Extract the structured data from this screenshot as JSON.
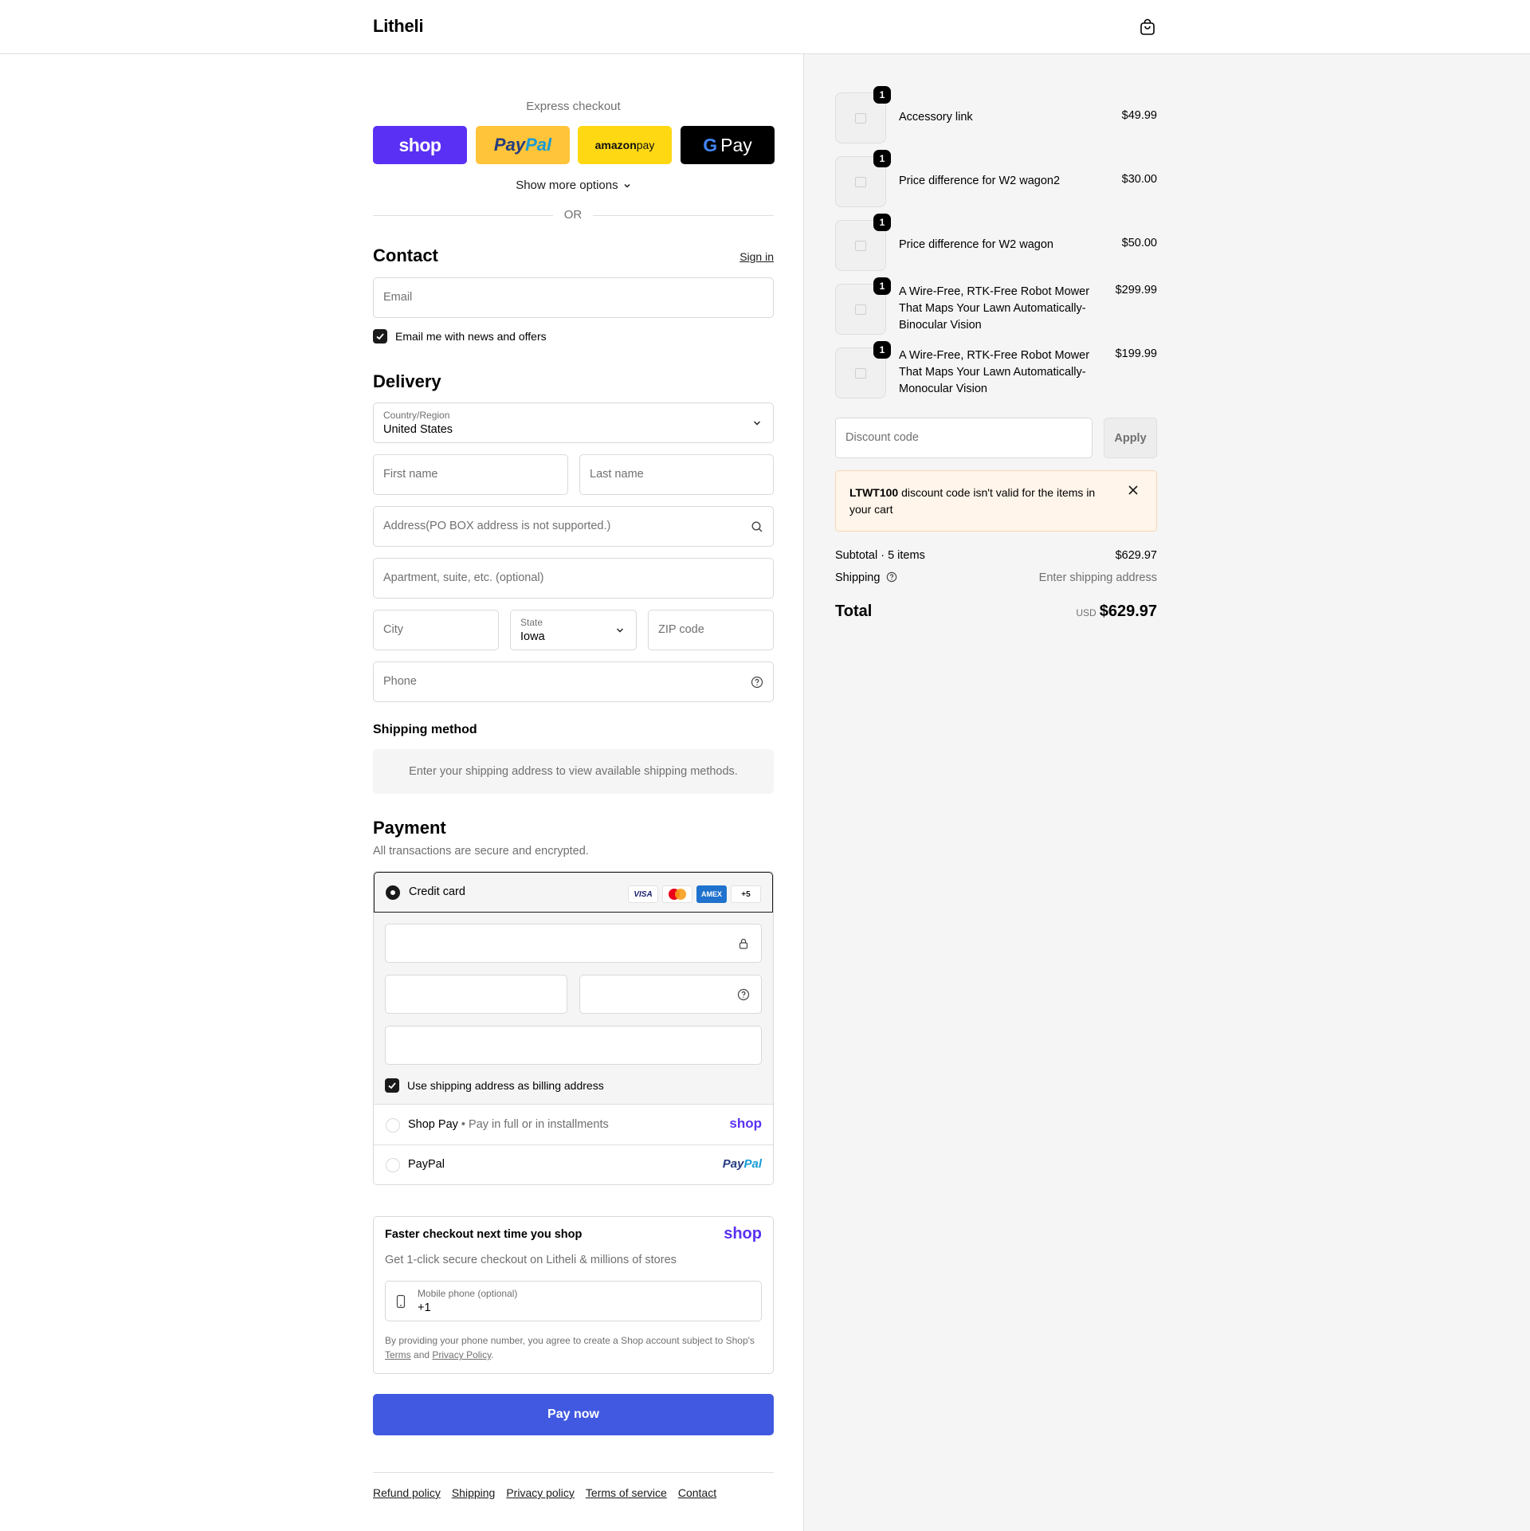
{
  "header": {
    "logo": "Litheli",
    "cart_icon": "bag-icon"
  },
  "express": {
    "title": "Express checkout",
    "shop_label": "shop",
    "paypal_label_1": "Pay",
    "paypal_label_2": "Pal",
    "amazon_label_1": "amazon",
    "amazon_label_2": " pay",
    "gpay_g": "G",
    "gpay_label": "Pay",
    "more_options": "Show more options",
    "or": "OR"
  },
  "contact": {
    "title": "Contact",
    "sign_in": "Sign in",
    "email_placeholder": "Email",
    "news_label": "Email me with news and offers",
    "news_checked": true
  },
  "delivery": {
    "title": "Delivery",
    "country_label": "Country/Region",
    "country_value": "United States",
    "first_name": "First name",
    "last_name": "Last name",
    "address": "Address(PO BOX address is not supported.)",
    "apartment": "Apartment, suite, etc. (optional)",
    "city": "City",
    "state_label": "State",
    "state_value": "Iowa",
    "zip": "ZIP code",
    "phone": "Phone"
  },
  "shipping_method": {
    "title": "Shipping method",
    "message": "Enter your shipping address to view available shipping methods."
  },
  "payment": {
    "title": "Payment",
    "subtitle": "All transactions are secure and encrypted.",
    "credit_card_label": "Credit card",
    "card_logos": [
      "VISA",
      "",
      "AMEX",
      "+5"
    ],
    "billing_label": "Use shipping address as billing address",
    "billing_checked": true,
    "shop_pay_label": "Shop Pay",
    "shop_pay_sub": "Pay in full or in installments",
    "shop_pay_logo": "shop",
    "paypal_label": "PayPal",
    "paypal_logo_1": "Pay",
    "paypal_logo_2": "Pal"
  },
  "shop_promo": {
    "title": "Faster checkout next time you shop",
    "logo": "shop",
    "subtitle": "Get 1-click secure checkout on Litheli & millions of stores",
    "phone_label": "Mobile phone (optional)",
    "phone_value": "+1",
    "legal_1": "By providing your phone number, you agree to create a Shop account subject to Shop's",
    "terms": "Terms",
    "and": "and",
    "privacy": "Privacy Policy",
    "period": "."
  },
  "pay_now": "Pay now",
  "footer_links": [
    "Refund policy",
    "Shipping",
    "Privacy policy",
    "Terms of service",
    "Contact"
  ],
  "order": {
    "items": [
      {
        "qty": "1",
        "name": "Accessory link",
        "price": "$49.99"
      },
      {
        "qty": "1",
        "name": "Price difference for W2 wagon2",
        "price": "$30.00"
      },
      {
        "qty": "1",
        "name": "Price difference for W2 wagon",
        "price": "$50.00"
      },
      {
        "qty": "1",
        "name": "A Wire-Free, RTK-Free Robot Mower That Maps Your Lawn Automatically-Binocular Vision",
        "price": "$299.99"
      },
      {
        "qty": "1",
        "name": "A Wire-Free, RTK-Free Robot Mower That Maps Your Lawn Automatically-Monocular Vision",
        "price": "$199.99"
      }
    ],
    "discount_placeholder": "Discount code",
    "apply": "Apply",
    "error_code": "LTWT100",
    "error_text": " discount code isn't valid for the items in your cart",
    "subtotal_label": "Subtotal · 5 items",
    "subtotal_value": "$629.97",
    "shipping_label": "Shipping",
    "shipping_value": "Enter shipping address",
    "total_label": "Total",
    "total_currency": "USD",
    "total_value": "$629.97"
  }
}
